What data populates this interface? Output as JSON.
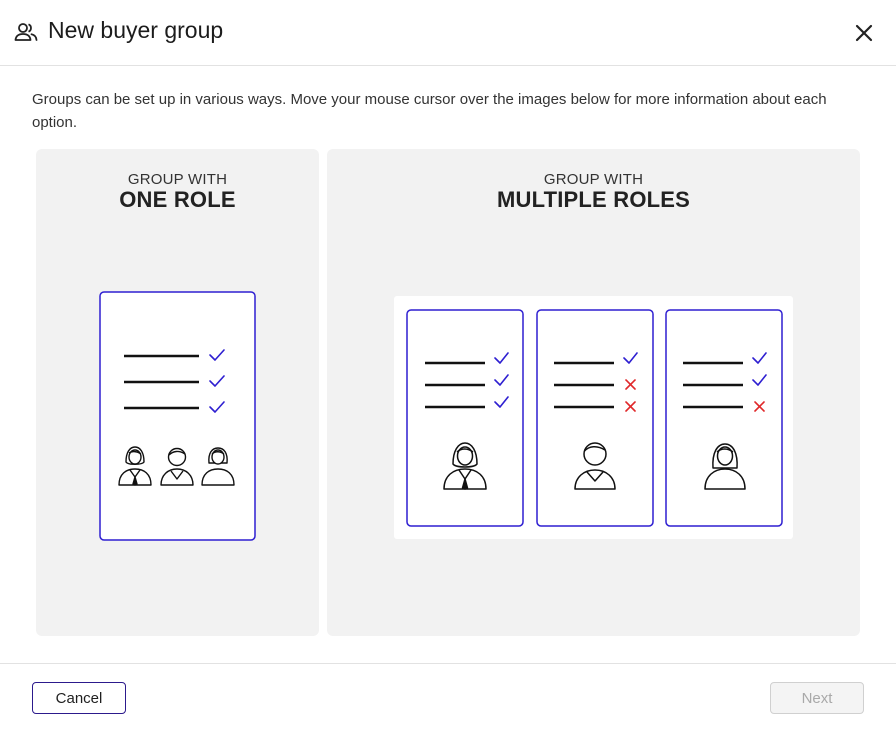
{
  "dialog": {
    "title": "New buyer group",
    "title_icon": "users-icon",
    "close_icon": "close-icon"
  },
  "intro": "Groups can be set up in various ways. Move your mouse cursor over the images below for more information about each option.",
  "options": [
    {
      "kicker": "GROUP WITH",
      "heading": "ONE ROLE"
    },
    {
      "kicker": "GROUP WITH",
      "heading": "MULTIPLE ROLES"
    }
  ],
  "colors": {
    "card_border": "#2e1fd1",
    "check": "#2e1fd1",
    "cross": "#e0292b",
    "panel_bg": "#f2f2f2"
  },
  "footer": {
    "cancel_label": "Cancel",
    "next_label": "Next"
  }
}
